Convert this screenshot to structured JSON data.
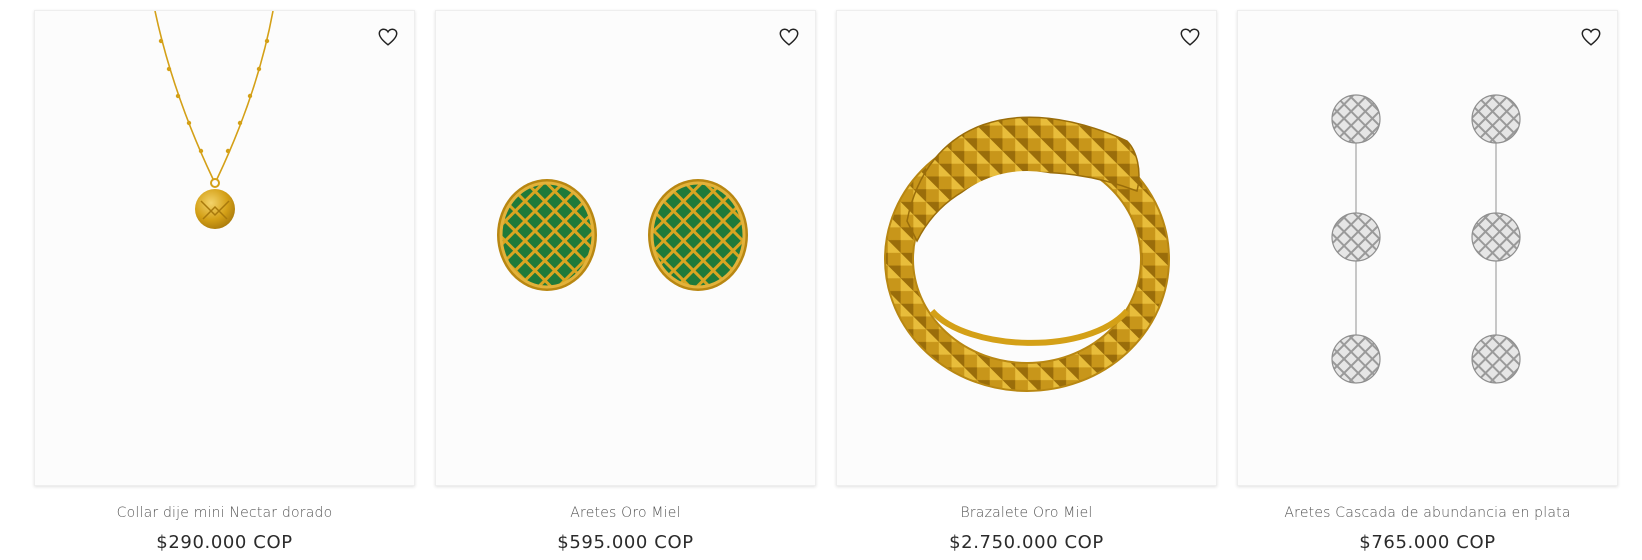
{
  "products": [
    {
      "name": "Collar dije mini Nectar dorado",
      "price": "$290.000 COP",
      "wishlist_icon": "heart-outline-icon",
      "image_icon": "gold-necklace-pendant"
    },
    {
      "name": "Aretes Oro Miel",
      "price": "$595.000 COP",
      "wishlist_icon": "heart-outline-icon",
      "image_icon": "gold-emerald-earrings"
    },
    {
      "name": "Brazalete Oro Miel",
      "price": "$2.750.000 COP",
      "wishlist_icon": "heart-outline-icon",
      "image_icon": "gold-textured-bracelet"
    },
    {
      "name": "Aretes Cascada de abundancia en plata",
      "price": "$765.000 COP",
      "wishlist_icon": "heart-outline-icon",
      "image_icon": "silver-drop-earrings"
    }
  ],
  "colors": {
    "gold": "#d4a017",
    "gold_dark": "#a8790c",
    "emerald": "#1f7a3a",
    "silver": "#c9c9c9"
  }
}
